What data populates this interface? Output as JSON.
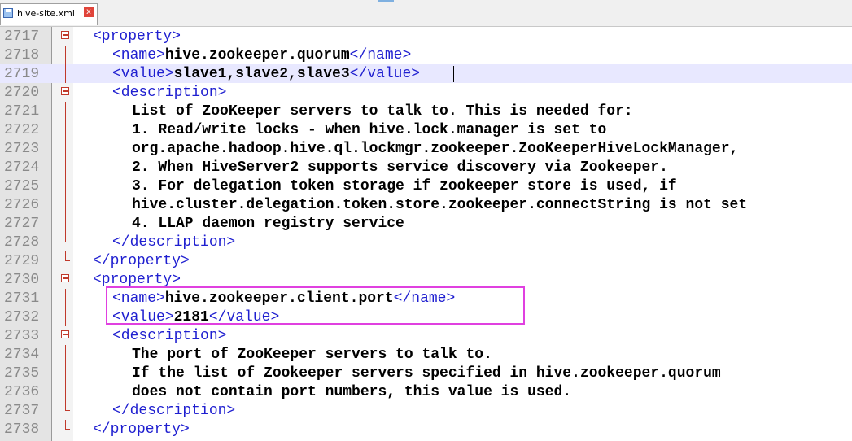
{
  "tab": {
    "label": "hive-site.xml",
    "close": "x"
  },
  "lines": [
    {
      "num": "2717",
      "open": "<property>",
      "text": "",
      "close": ""
    },
    {
      "num": "2718",
      "open": "<name>",
      "text": "hive.zookeeper.quorum",
      "close": "</name>"
    },
    {
      "num": "2719",
      "open": "<value>",
      "text": "slave1,slave2,slave3",
      "close": "</value>"
    },
    {
      "num": "2720",
      "open": "<description>",
      "text": "",
      "close": ""
    },
    {
      "num": "2721",
      "open": "",
      "text": "List of ZooKeeper servers to talk to. This is needed for:",
      "close": ""
    },
    {
      "num": "2722",
      "open": "",
      "text": "1. Read/write locks - when hive.lock.manager is set to",
      "close": ""
    },
    {
      "num": "2723",
      "open": "",
      "text": "org.apache.hadoop.hive.ql.lockmgr.zookeeper.ZooKeeperHiveLockManager,",
      "close": ""
    },
    {
      "num": "2724",
      "open": "",
      "text": "2. When HiveServer2 supports service discovery via Zookeeper.",
      "close": ""
    },
    {
      "num": "2725",
      "open": "",
      "text": "3. For delegation token storage if zookeeper store is used, if",
      "close": ""
    },
    {
      "num": "2726",
      "open": "",
      "text": "hive.cluster.delegation.token.store.zookeeper.connectString is not set",
      "close": ""
    },
    {
      "num": "2727",
      "open": "",
      "text": "4. LLAP daemon registry service",
      "close": ""
    },
    {
      "num": "2728",
      "open": "",
      "text": "",
      "close": "</description>"
    },
    {
      "num": "2729",
      "open": "",
      "text": "",
      "close": "</property>"
    },
    {
      "num": "2730",
      "open": "<property>",
      "text": "",
      "close": ""
    },
    {
      "num": "2731",
      "open": "<name>",
      "text": "hive.zookeeper.client.port",
      "close": "</name>"
    },
    {
      "num": "2732",
      "open": "<value>",
      "text": "2181",
      "close": "</value>"
    },
    {
      "num": "2733",
      "open": "<description>",
      "text": "",
      "close": ""
    },
    {
      "num": "2734",
      "open": "",
      "text": "The port of ZooKeeper servers to talk to.",
      "close": ""
    },
    {
      "num": "2735",
      "open": "",
      "text": "If the list of Zookeeper servers specified in hive.zookeeper.quorum",
      "close": ""
    },
    {
      "num": "2736",
      "open": "",
      "text": "does not contain port numbers, this value is used.",
      "close": ""
    },
    {
      "num": "2737",
      "open": "",
      "text": "",
      "close": "</description>"
    },
    {
      "num": "2738",
      "open": "",
      "text": "",
      "close": "</property>"
    }
  ]
}
